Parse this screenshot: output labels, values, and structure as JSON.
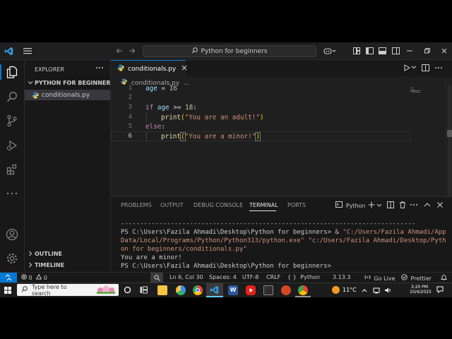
{
  "window": {
    "search_text": "Python for beginners"
  },
  "sidebar": {
    "title": "EXPLORER",
    "folder": "PYTHON FOR BEGINNERS",
    "file": "conditionals.py",
    "outline": "OUTLINE",
    "timeline": "TIMELINE"
  },
  "editor": {
    "tab_label": "conditionals.py",
    "breadcrumb_file": "conditionals.py",
    "breadcrumb_more": "...",
    "line_numbers": [
      "1",
      "2",
      "3",
      "4",
      "5",
      "6"
    ],
    "code": {
      "l1_var": "age",
      "l1_op": " = ",
      "l1_num": "16",
      "l3_kw": "if",
      "l3_var": " age",
      "l3_op": " >= ",
      "l3_num": "18",
      "l3_colon": ":",
      "l4_fn": "print",
      "l4_open": "(",
      "l4_str": "\"You are an adult!\"",
      "l4_close": ")",
      "l5_kw": "else",
      "l5_colon": ":",
      "l6_fn": "print",
      "l6_open": "(",
      "l6_str": "\"You are a minor!\"",
      "l6_close": ")"
    }
  },
  "panel": {
    "tabs": [
      "PROBLEMS",
      "OUTPUT",
      "DEBUG CONSOLE",
      "TERMINAL",
      "PORTS"
    ],
    "terminal_label": "Python",
    "separator": "-----------------------------------------------------------------------------",
    "line1_prompt": "PS C:\\Users\\Fazila Ahmadi\\Desktop\\Python for beginners> & ",
    "line1_str": "\"C:/Users/Fazila Ahmadi/App",
    "line2_str": "Data/Local/Programs/Python/Python313/python.exe\" \"c:/Users/Fazila Ahmadi/Desktop/Pyth",
    "line3_str": "on for beginners/conditionals.py\"",
    "output": "You are a minor!",
    "prompt2": "PS C:\\Users\\Fazila Ahmadi\\Desktop\\Python for beginners>"
  },
  "statusbar": {
    "problems": "0",
    "warnings": "0",
    "position": "Ln 6, Col 30",
    "spaces": "Spaces: 4",
    "encoding": "UTF-8",
    "eol": "CRLF",
    "language": "Python",
    "version": "3.13.3",
    "golive": "Go Live",
    "prettier": "Prettier"
  },
  "taskbar": {
    "search_placeholder": "Type here to search",
    "weather": "11°C",
    "time": "3:20 PM",
    "date": "10/4/2025"
  },
  "colors": {
    "accent": "#0078d4",
    "statusbar_remote": "#0078d4"
  }
}
